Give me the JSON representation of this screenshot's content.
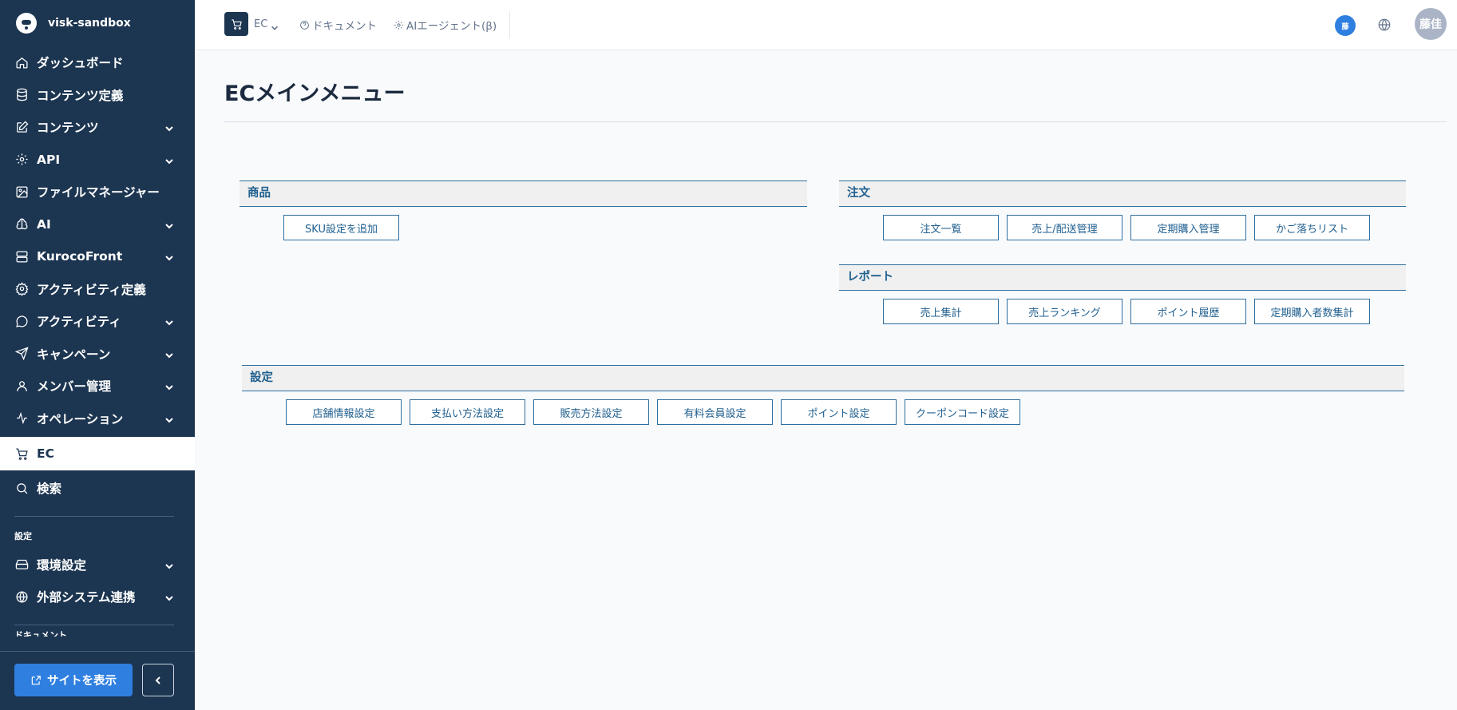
{
  "brand": {
    "name": "visk-sandbox"
  },
  "sidebar": {
    "items": [
      {
        "label": "ダッシュボード",
        "icon": "home-icon",
        "expandable": false
      },
      {
        "label": "コンテンツ定義",
        "icon": "database-icon",
        "expandable": false
      },
      {
        "label": "コンテンツ",
        "icon": "edit-icon",
        "expandable": true
      },
      {
        "label": "API",
        "icon": "api-gear-icon",
        "expandable": true
      },
      {
        "label": "ファイルマネージャー",
        "icon": "image-icon",
        "expandable": false
      },
      {
        "label": "AI",
        "icon": "ai-brain-icon",
        "expandable": true
      },
      {
        "label": "KurocoFront",
        "icon": "server-icon",
        "expandable": true
      },
      {
        "label": "アクティビティ定義",
        "icon": "settings-gear-icon",
        "expandable": false
      },
      {
        "label": "アクティビティ",
        "icon": "message-circle-icon",
        "expandable": true
      },
      {
        "label": "キャンペーン",
        "icon": "send-icon",
        "expandable": true
      },
      {
        "label": "メンバー管理",
        "icon": "user-icon",
        "expandable": true
      },
      {
        "label": "オペレーション",
        "icon": "activity-icon",
        "expandable": true
      },
      {
        "label": "EC",
        "icon": "cart-icon",
        "expandable": false,
        "active": true
      },
      {
        "label": "検索",
        "icon": "search-icon",
        "expandable": false
      }
    ],
    "settings_section": "設定",
    "settings_items": [
      {
        "label": "環境設定",
        "icon": "hard-drive-icon",
        "expandable": true
      },
      {
        "label": "外部システム連携",
        "icon": "globe-icon",
        "expandable": true
      }
    ],
    "docs_section": "ドキュメント",
    "site_button": "サイトを表示"
  },
  "topbar": {
    "module": "EC",
    "links": [
      {
        "label": "ドキュメント",
        "icon": "help-circle-icon"
      },
      {
        "label": "AIエージェント(β)",
        "icon": "ai-gear-icon"
      }
    ],
    "user_badge": "藤",
    "avatar": "藤佳"
  },
  "page": {
    "title": "ECメインメニュー"
  },
  "sections": {
    "product": {
      "title": "商品",
      "buttons": [
        "SKU設定を追加"
      ]
    },
    "order": {
      "title": "注文",
      "buttons": [
        "注文一覧",
        "売上/配送管理",
        "定期購入管理",
        "かご落ちリスト"
      ]
    },
    "report": {
      "title": "レポート",
      "buttons": [
        "売上集計",
        "売上ランキング",
        "ポイント履歴",
        "定期購入者数集計"
      ]
    },
    "settings": {
      "title": "設定",
      "buttons": [
        "店舗情報設定",
        "支払い方法設定",
        "販売方法設定",
        "有料会員設定",
        "ポイント設定",
        "クーポンコード設定"
      ]
    }
  },
  "colors": {
    "sidebar_bg": "#1c3551",
    "accent": "#2f7fe0",
    "section_border": "#2f6f9f"
  }
}
